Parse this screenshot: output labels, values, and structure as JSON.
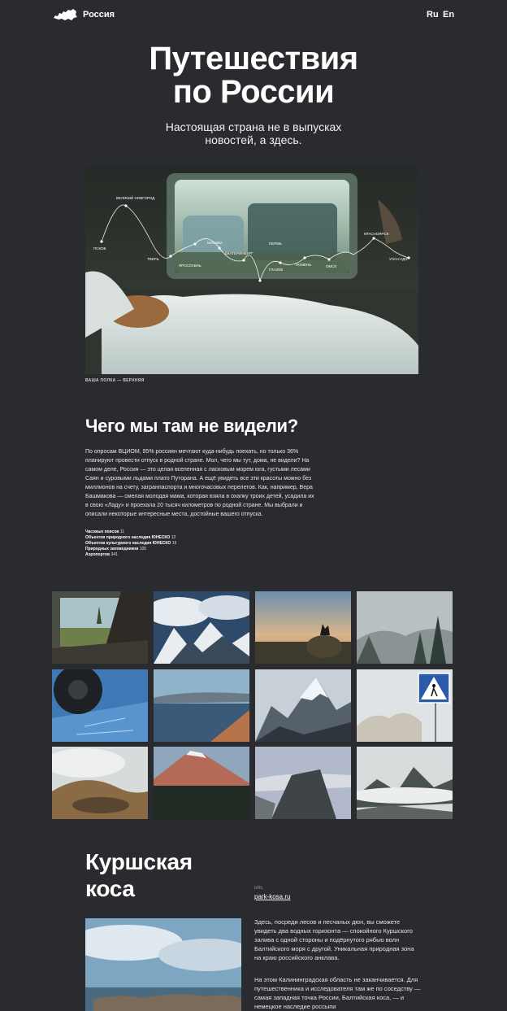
{
  "header": {
    "brand": "Россия",
    "lang_ru": "Ru",
    "lang_en": "En"
  },
  "hero": {
    "title_line1": "Путешествия",
    "title_line2": "по России",
    "subtitle_line1": "Настоящая страна не в выпусках",
    "subtitle_line2": "новостей, а здесь.",
    "caption": "ВАША ПОЛКА — ВЕРХНЯЯ",
    "route": [
      {
        "label": "ПСКОВ"
      },
      {
        "label": "ВЕЛИКИЙ НОВГОРОД"
      },
      {
        "label": "ТВЕРЬ"
      },
      {
        "label": "ЯРОСЛАВЛЬ"
      },
      {
        "label": "МОСКВА"
      },
      {
        "label": "ЕКАТЕРИНБУРГ"
      },
      {
        "label": "ПЕРМЬ"
      },
      {
        "label": "ГЛАЗОВ"
      },
      {
        "label": "ТЮМЕНЬ"
      },
      {
        "label": "ОМСК"
      },
      {
        "label": "КРАСНОЯРСК"
      },
      {
        "label": "УЛАН-УДЭ"
      }
    ]
  },
  "section": {
    "heading": "Чего мы там не видели?",
    "intro": "По опросам ВЦИОМ, 95% россиян мечтают куда-нибудь поехать, но только 36% планируют провести отпуск в родной стране. Мол, чего мы тут, дома, не видели? На самом деле, Россия — это целая вселенная с ласковым морем юга, густыми лесами Саян и суровыми льдами плато Путорана. А ещё увидеть все эти красоты можно без миллионов на счету, загранпаспорта и многочасовых перелетов. Как, например, Вера Башмакова — смелая молодая мама, которая взяла в охапку троих детей, усадила их в свою «Ладу» и проехала 20 тысяч километров по родной стране. Мы выбрали и описали некоторые интересные места, достойные вашего отпуска.",
    "stats": [
      {
        "label": "Часовых поясов",
        "value": "11"
      },
      {
        "label": "Объектов природного наследия ЮНЕСКО",
        "value": "12"
      },
      {
        "label": "Объектов культурного наследия ЮНЕСКО",
        "value": "16"
      },
      {
        "label": "Природных заповедников",
        "value": "105"
      },
      {
        "label": "Аэропортов",
        "value": "341"
      }
    ]
  },
  "kosa": {
    "heading_line1": "Куршская",
    "heading_line2": "коса",
    "url_label": "URL",
    "url": "park-kosa.ru",
    "p1": "Здесь, посреди лесов и песчаных дюн, вы сможете увидеть два водных горизонта — спокойного Куршского залива с одной стороны и подёрнутого рябью волн Балтийского моря с другой. Уникальная природная зона на краю российского анклава.",
    "p2": "На этом Калининградская область не заканчивается. Для путешественника и исследователя там же по соседству — самая западная точка России, Балтийская коса, — и немецкое наследие россыпи"
  },
  "colors": {
    "background": "#2a2b2e",
    "text": "#ffffff"
  }
}
